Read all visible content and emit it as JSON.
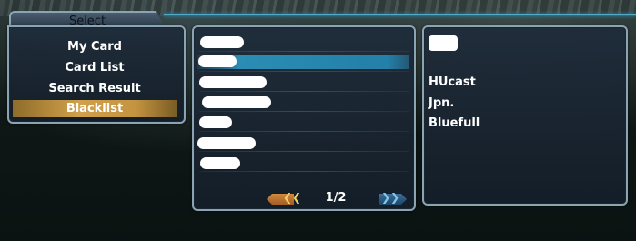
{
  "select_tab": {
    "label": "Select"
  },
  "menu": {
    "items": [
      {
        "label": "My Card",
        "selected": false
      },
      {
        "label": "Card List",
        "selected": false
      },
      {
        "label": "Search Result",
        "selected": false
      },
      {
        "label": "Blacklist",
        "selected": true
      }
    ]
  },
  "list": {
    "rows": [
      {
        "name_redacted": true,
        "selected": false
      },
      {
        "name_redacted": true,
        "selected": true
      },
      {
        "name_redacted": true,
        "selected": false
      },
      {
        "name_redacted": true,
        "selected": false
      },
      {
        "name_redacted": true,
        "selected": false
      },
      {
        "name_redacted": true,
        "selected": false
      },
      {
        "name_redacted": true,
        "selected": false
      }
    ],
    "pager": {
      "page": "1/2",
      "prev_icon": "prev-arrow-icon",
      "next_icon": "next-arrow-icon"
    }
  },
  "detail": {
    "name_redacted": true,
    "class": "HUcast",
    "language": "Jpn.",
    "section_id": "Bluefull"
  },
  "colors": {
    "panel_border": "#8aa4b4",
    "menu_highlight": "#d0a04a",
    "list_highlight": "#2b8db4",
    "prev_arrow": "#d28a3e",
    "next_arrow": "#3d6f9a"
  }
}
